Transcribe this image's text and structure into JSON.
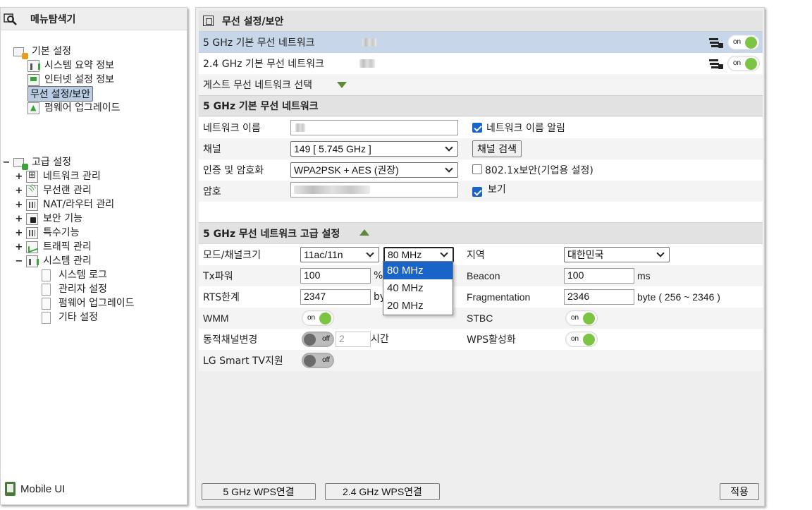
{
  "left_panel": {
    "title": "메뉴탐색기",
    "basic": {
      "label": "기본 설정",
      "items": [
        "시스템 요약 정보",
        "인터넷 설정 정보",
        "무선 설정/보안",
        "펌웨어 업그레이드"
      ]
    },
    "advanced": {
      "expander": "−",
      "label": "고급 설정",
      "groups": [
        "네트워크 관리",
        "무선랜 관리",
        "NAT/라우터 관리",
        "보안 기능",
        "특수기능",
        "트래픽 관리",
        "시스템 관리"
      ],
      "group_expanders": [
        "+",
        "+",
        "+",
        "+",
        "+",
        "+",
        "−"
      ],
      "system_items": [
        "시스템 로그",
        "관리자 설정",
        "펌웨어 업그레이드",
        "기타 설정"
      ]
    },
    "mobile_ui": "Mobile UI"
  },
  "header": {
    "title": "무선 설정/보안"
  },
  "networks": [
    {
      "name": "5 GHz 기본 무선 네트워크",
      "toggle": "on"
    },
    {
      "name": "2.4 GHz 기본 무선 네트워크",
      "toggle": "on"
    }
  ],
  "guest": {
    "label": "게스트 무선 네트워크 선택"
  },
  "basic5g": {
    "title": "5 GHz 기본 무선 네트워크",
    "network_name_label": "네트워크 이름",
    "broadcast_label": "네트워크 이름 알림",
    "channel_label": "채널",
    "channel_value": "149 [ 5.745 GHz ]",
    "channel_search": "채널 검색",
    "auth_label": "인증 및 암호화",
    "auth_value": "WPA2PSK + AES (권장)",
    "enterprise_label": "802.1x보안(기업용 설정)",
    "password_label": "암호",
    "show_label": "보기"
  },
  "advanced5g": {
    "title": "5 GHz 무선 네트워크 고급 설정",
    "mode_label": "모드/채널크기",
    "mode_value": "11ac/11n",
    "width_value": "80 MHz",
    "width_options": [
      "80 MHz",
      "40 MHz",
      "20 MHz"
    ],
    "region_label": "지역",
    "region_value": "대한민국",
    "tx_label": "Tx파워",
    "tx_value": "100",
    "tx_unit": "%",
    "beacon_label": "Beacon",
    "beacon_value": "100",
    "beacon_unit": "ms",
    "rts_label": "RTS한계",
    "rts_value": "2347",
    "rts_unit": "by",
    "frag_label": "Fragmentation",
    "frag_value": "2346",
    "frag_unit": "byte ( 256 ~ 2346 )",
    "wmm_label": "WMM",
    "wmm_toggle": "on",
    "stbc_label": "STBC",
    "stbc_toggle": "on",
    "dyn_label": "동적채널변경",
    "dyn_toggle": "off",
    "dyn_value": "2",
    "dyn_unit": "시간",
    "wps_label": "WPS활성화",
    "wps_toggle": "on",
    "lg_label": "LG Smart TV지원",
    "lg_toggle": "off"
  },
  "footer": {
    "wps5": "5 GHz WPS연결",
    "wps24": "2.4 GHz WPS연결",
    "apply": "적용"
  },
  "colors": {
    "selected_row": "#c7d6e8",
    "toggle_on": "#7cc444",
    "dropdown_highlight": "#1a64c8"
  }
}
